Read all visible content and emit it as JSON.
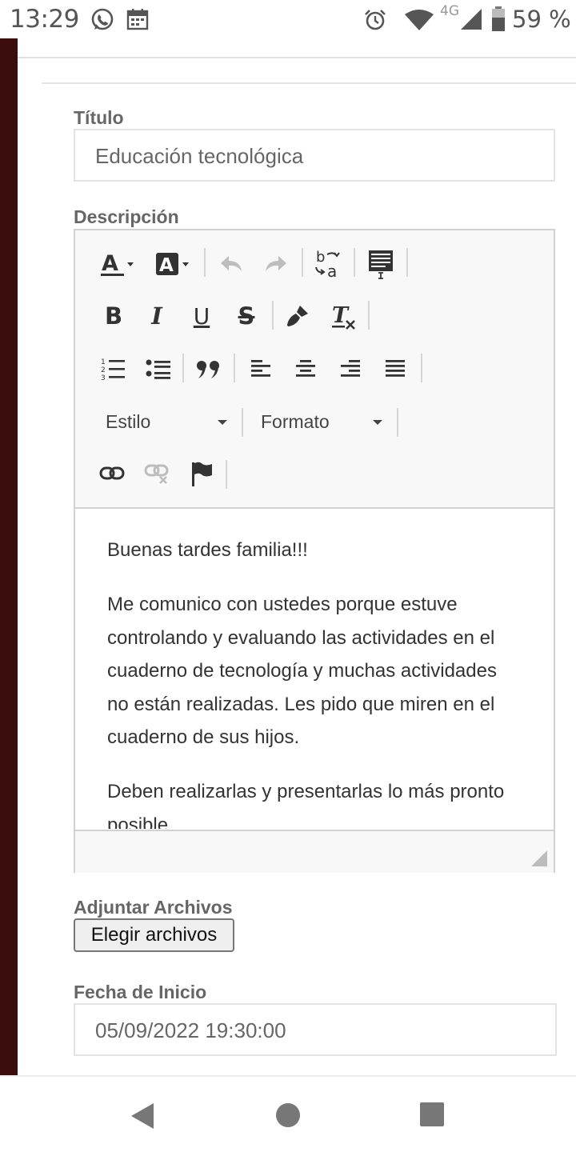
{
  "status_bar": {
    "time": "13:29",
    "network": "4G",
    "battery": "59 %",
    "icons": [
      "whatsapp-icon",
      "calendar-icon",
      "alarm-icon",
      "wifi-icon",
      "signal-icon",
      "battery-icon"
    ]
  },
  "form": {
    "title_label": "Título",
    "title_value": "Educación tecnológica",
    "description_label": "Descripción",
    "toolbar": {
      "style_combo": "Estilo",
      "format_combo": "Formato",
      "bold": "B",
      "italic": "I",
      "underline": "U",
      "strike": "S"
    },
    "content": {
      "p1": "Buenas tardes familia!!!",
      "p2": "Me comunico con ustedes porque estuve controlando y evaluando las actividades en el cuaderno de tecnología y muchas actividades no están realizadas. Les pido que miren  en el cuaderno de sus hijos.",
      "p3": "Deben realizarlas y presentarlas lo más pronto posible."
    },
    "attach_label": "Adjuntar Archivos",
    "attach_button": "Elegir archivos",
    "start_date_label": "Fecha de Inicio",
    "start_date_value": "05/09/2022 19:30:00"
  },
  "colors": {
    "left_strip": "#3d0d0e",
    "label_text": "#666666",
    "toolbar_bg": "#f8f8f8"
  }
}
